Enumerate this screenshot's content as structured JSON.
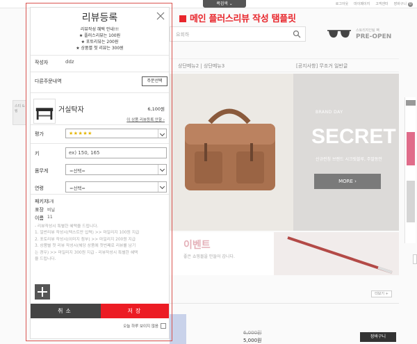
{
  "background": {
    "top_pill": "콕검색 ⌄",
    "top_links": [
      "로그아웃",
      "마이페이지",
      "고객센터",
      "장바구니"
    ],
    "cart_count": "0",
    "template_title": "메인 플러스리뷰 작성 탬플릿",
    "search_placeholder": "요회하",
    "preopen_small": "스토리지인팀 팩",
    "preopen_big": "PRE-OPEN",
    "nav_items": "상단메뉴2  |  상단메뉴3",
    "nav_notice": "[공지사항] 무조거 일반글",
    "left_thumb_text": "스티 & 링",
    "banner_brandday": "BRAND DAY",
    "banner_headline": "SECRET B",
    "banner_sub": "신규런칭 브랜드 시크릿블루, 주말동안",
    "banner_more": "MORE ›",
    "event_title": "이벤트",
    "event_desc": "좋은 쇼핑몰을 만들어 갑니다.",
    "more_button": "더보기 +",
    "price_old": "6,000원",
    "price_new": "5,000원",
    "cart_button": "장바구니"
  },
  "modal": {
    "title": "리뷰등록",
    "notice_lines": [
      "리뷰작성 혜택 안내!!!",
      "★ 플러스리뷰는 100원",
      "★ 포토리뷰는 200원",
      "★ 상품별 첫 리뷰는 300원"
    ],
    "author_label": "작성자",
    "author_value": "ddz",
    "order_section_label": "다른주문내역",
    "order_select_button": "주문선택",
    "product": {
      "name": "거실탁자",
      "price": "6,100원",
      "link": "이 상품 리뷰등록 안함 ›"
    },
    "rating_label": "평가",
    "rating_value": "★★★★★",
    "height_label": "키",
    "height_placeholder": "ex) 150, 165",
    "weight_label": "몸무게",
    "weight_value": "=선택=",
    "age_label": "연령",
    "age_value": "=선택=",
    "info_rows": [
      {
        "label": "패키지",
        "value": "5개"
      },
      {
        "label": "포장",
        "value": "비닐"
      },
      {
        "label": "이름",
        "value": "11"
      }
    ],
    "guide_lines": [
      "- 리뷰작성시 특별한 혜택을 드립니다.",
      "1. 일반리뷰 작성시(텍스트만 입력) >> 마일리지 100원 지급",
      "2. 포토리뷰 작성시(이미지 첨부) >> 마일리지 200원 지급",
      "3. 상품별 첫 리뷰 작성시(해당 상품에 첫번째로 리뷰를 남기",
      "는 경우) >> 마일리지 300원 지급 - 리뷰작성시 특별한 혜택",
      "을 드립니다."
    ],
    "cancel_button": "취소",
    "save_button": "저장",
    "hide_today": "오늘 하루 보이지 않음"
  },
  "colors": {
    "accent_red": "#ec1c24",
    "dark_button": "#444444",
    "star": "#e4b400"
  }
}
